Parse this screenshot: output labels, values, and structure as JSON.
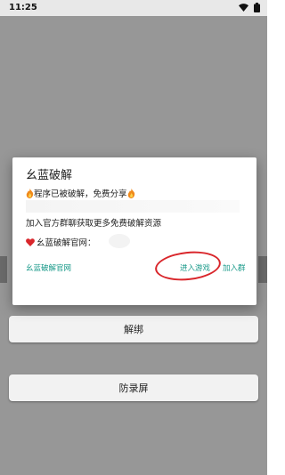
{
  "status_bar": {
    "time": "11:25",
    "icons": [
      "wifi-icon",
      "battery-icon"
    ]
  },
  "background": {
    "buttons": [
      {
        "label": "解绑"
      },
      {
        "label": "防录屏"
      }
    ]
  },
  "dialog": {
    "title": "幺蓝破解",
    "line1_text": "程序已被破解，免费分享",
    "line2_text": "加入官方群聊获取更多免费破解资源",
    "line3_text": "幺蓝破解官网：",
    "actions": {
      "official_site": "幺蓝破解官网",
      "enter_game": "进入游戏",
      "join_group": "加入群"
    }
  },
  "colors": {
    "accent_link": "#1a9a8a",
    "highlight_ellipse": "#d9262b",
    "heart": "#d9262b",
    "flame": "#f08a1c"
  }
}
